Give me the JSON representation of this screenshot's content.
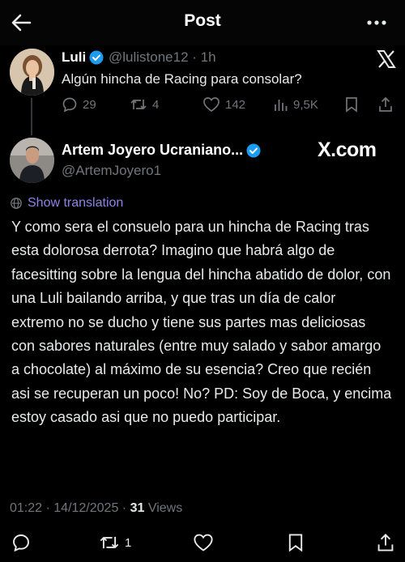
{
  "header": {
    "title": "Post"
  },
  "original_post": {
    "name": "Luli",
    "handle": "@lulistone12",
    "time": "1h",
    "text": "Algún hincha de Racing para consolar?",
    "actions": {
      "replies": "29",
      "reposts": "4",
      "likes": "142",
      "views": "9,5K"
    }
  },
  "reply_post": {
    "name": "Artem Joyero Ucraniano...",
    "handle": "@ArtemJoyero1",
    "watermark": "X.com",
    "translate_label": "Show translation",
    "body": "Y como sera el consuelo para un hincha de Racing tras esta dolorosa derrota? Imagino que habrá algo de facesitting sobre la lengua del hincha abatido de dolor, con una Luli bailando arriba, y que tras un día de calor extremo no se ducho y tiene sus partes mas deliciosas con sabores naturales (entre muy salado y sabor amargo a chocolate) al máximo de su esencia? Creo que recién asi se recuperan un poco! No?  PD: Soy de Boca, y encima estoy casado asi que no puedo participar.",
    "time": "01:22",
    "date": "14/12/2025",
    "views_count": "31",
    "views_label": "Views",
    "reposts": "1"
  },
  "colors": {
    "background": "#000000",
    "verified": "#1d9bf0",
    "link": "#8e83e8",
    "muted": "#71767b"
  }
}
